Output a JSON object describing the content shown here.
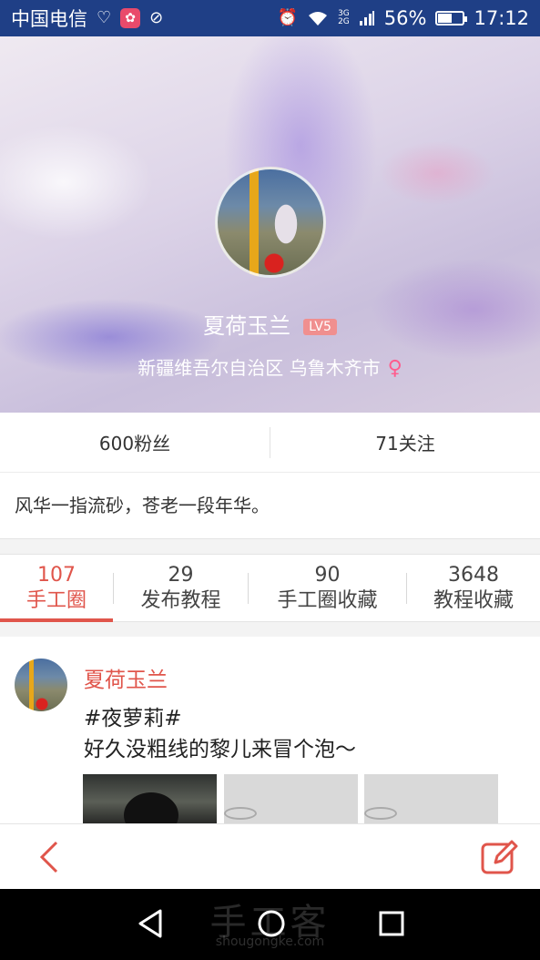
{
  "status_bar": {
    "carrier": "中国电信",
    "network_badge_top": "3G",
    "network_badge_bottom": "2G",
    "battery_percent": "56%",
    "battery_level": 0.56,
    "time": "17:12"
  },
  "profile": {
    "username": "夏荷玉兰",
    "level": "LV5",
    "location": "新疆维吾尔自治区 乌鲁木齐市",
    "gender_symbol": "♀"
  },
  "stats": {
    "followers": "600粉丝",
    "following": "71关注"
  },
  "bio": "风华一指流砂，苍老一段年华。",
  "tabs": [
    {
      "count": "107",
      "label": "手工圈"
    },
    {
      "count": "29",
      "label": "发布教程"
    },
    {
      "count": "90",
      "label": "手工圈收藏"
    },
    {
      "count": "3648",
      "label": "教程收藏"
    }
  ],
  "post": {
    "author": "夏荷玉兰",
    "tag": "#夜萝莉#",
    "text": "好久没粗线的黎儿来冒个泡～"
  },
  "watermark": {
    "main": "手工客",
    "sub": "shougongke.com"
  },
  "colors": {
    "accent": "#e0554b",
    "status_bar": "#1f3f86",
    "level_badge": "#f08f8f",
    "gender": "#ff5c8d"
  }
}
